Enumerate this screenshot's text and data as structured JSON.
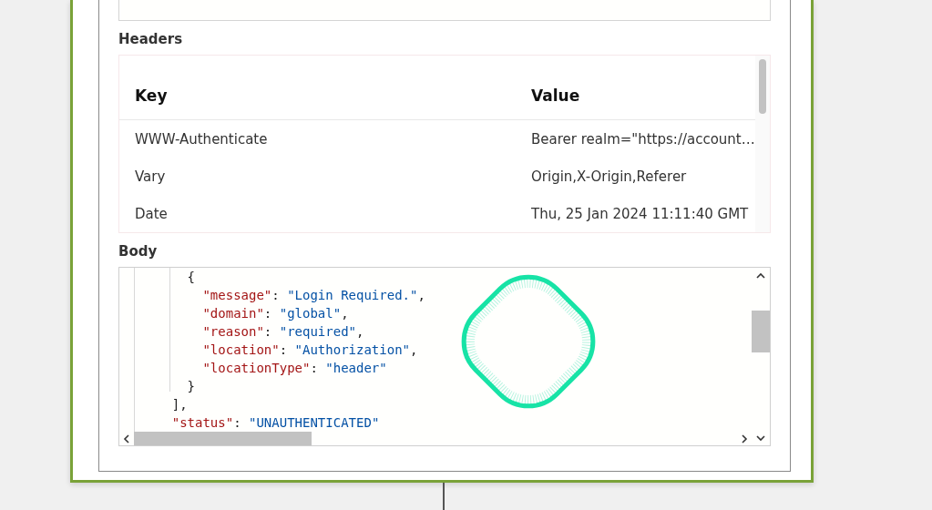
{
  "headers": {
    "label": "Headers",
    "columns": [
      "Key",
      "Value"
    ],
    "rows": [
      {
        "key": "WWW-Authenticate",
        "value": "Bearer realm=\"https://account…"
      },
      {
        "key": "Vary",
        "value": "Origin,X-Origin,Referer"
      },
      {
        "key": "Date",
        "value": "Thu, 25 Jan 2024 11:11:40 GMT"
      }
    ]
  },
  "body": {
    "label": "Body",
    "lines": [
      [
        {
          "kind": "punct",
          "text": "      {"
        }
      ],
      [
        {
          "kind": "key",
          "text": "        \"message\""
        },
        {
          "kind": "punct",
          "text": ": "
        },
        {
          "kind": "str",
          "text": "\"Login Required.\""
        },
        {
          "kind": "punct",
          "text": ","
        }
      ],
      [
        {
          "kind": "key",
          "text": "        \"domain\""
        },
        {
          "kind": "punct",
          "text": ": "
        },
        {
          "kind": "str",
          "text": "\"global\""
        },
        {
          "kind": "punct",
          "text": ","
        }
      ],
      [
        {
          "kind": "key",
          "text": "        \"reason\""
        },
        {
          "kind": "punct",
          "text": ": "
        },
        {
          "kind": "str",
          "text": "\"required\""
        },
        {
          "kind": "punct",
          "text": ","
        }
      ],
      [
        {
          "kind": "key",
          "text": "        \"location\""
        },
        {
          "kind": "punct",
          "text": ": "
        },
        {
          "kind": "str",
          "text": "\"Authorization\""
        },
        {
          "kind": "punct",
          "text": ","
        }
      ],
      [
        {
          "kind": "key",
          "text": "        \"locationType\""
        },
        {
          "kind": "punct",
          "text": ": "
        },
        {
          "kind": "str",
          "text": "\"header\""
        }
      ],
      [
        {
          "kind": "punct",
          "text": "      }"
        }
      ],
      [
        {
          "kind": "punct",
          "text": "    ],"
        }
      ],
      [
        {
          "kind": "key",
          "text": "    \"status\""
        },
        {
          "kind": "punct",
          "text": ": "
        },
        {
          "kind": "str",
          "text": "\"UNAUTHENTICATED\""
        }
      ]
    ]
  }
}
